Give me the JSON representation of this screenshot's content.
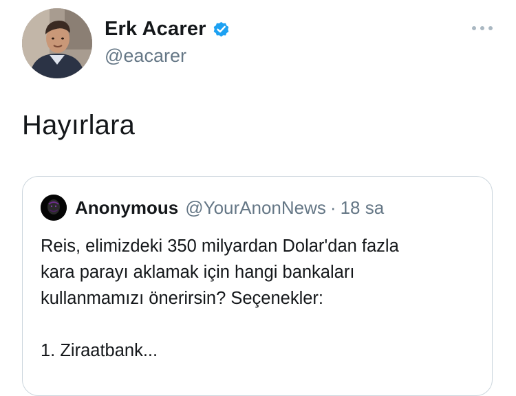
{
  "author": {
    "name": "Erk Acarer",
    "handle": "@eacarer",
    "avatar_icon": "profile-photo",
    "verified_icon": "verified-badge-icon",
    "verified_color": "#1da1f2"
  },
  "menu": {
    "icon": "more-options-icon"
  },
  "tweet": {
    "text": "Hayırlara"
  },
  "quoted_tweet": {
    "name": "Anonymous",
    "handle": "@YourAnonNews",
    "separator": "·",
    "time": "18 sa",
    "avatar_icon": "anonymous-mask-avatar",
    "lines": [
      "Reis, elimizdeki 350 milyardan Dolar'dan fazla",
      "kara parayı aklamak için hangi bankaları",
      "kullanmamızı önerirsin? Seçenekler:",
      "",
      "1. Ziraatbank..."
    ]
  },
  "colors": {
    "text": "#14171a",
    "secondary": "#657786",
    "border": "#ccd6dd",
    "accent": "#1da1f2"
  }
}
